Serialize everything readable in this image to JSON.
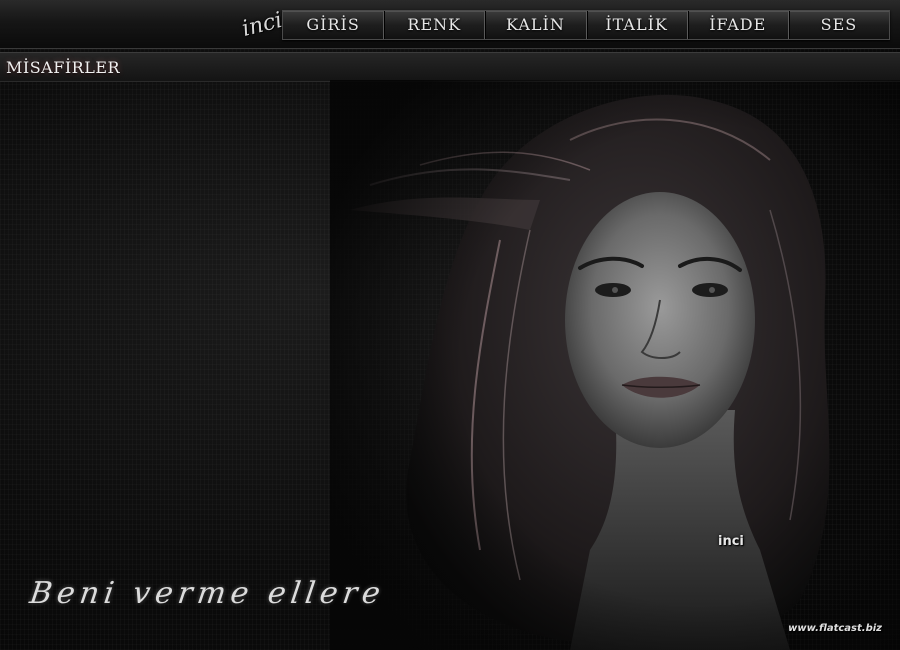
{
  "logo": {
    "text": "inci"
  },
  "nav": {
    "items": [
      {
        "label": "GİRİS"
      },
      {
        "label": "RENK"
      },
      {
        "label": "KALİN"
      },
      {
        "label": "İTALİK"
      },
      {
        "label": "İFADE"
      },
      {
        "label": "SES"
      }
    ]
  },
  "section": {
    "title": "MİSAFİRLER"
  },
  "artwork": {
    "signature": "inci",
    "tagline": "Beni verme ellere"
  },
  "footer": {
    "url": "www.flatcast.biz"
  },
  "colors": {
    "background": "#050505",
    "nav_text": "#e6e6e6",
    "hair_highlight": "#b89a9e"
  }
}
